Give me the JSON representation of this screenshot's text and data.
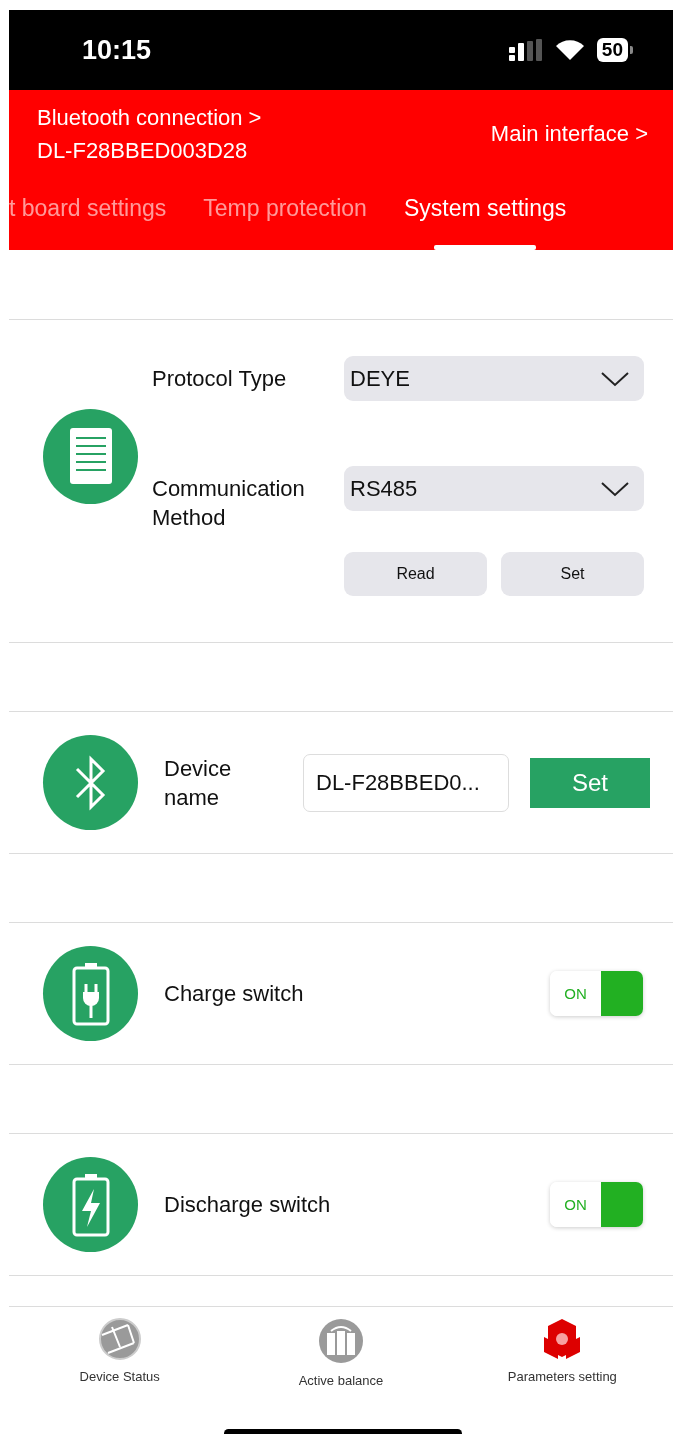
{
  "status_bar": {
    "time": "10:15",
    "battery": "50"
  },
  "header": {
    "connection_label": "Bluetooth connection >",
    "device_id": "DL-F28BBED003D28",
    "main_link": "Main interface >"
  },
  "tabs": [
    {
      "label": "t board settings",
      "selected": false
    },
    {
      "label": "Temp protection",
      "selected": false
    },
    {
      "label": "System settings",
      "selected": true
    }
  ],
  "protocol_section": {
    "fields": [
      {
        "label": "Protocol Type",
        "value": "DEYE"
      },
      {
        "label": "Communication Method",
        "value": "RS485"
      }
    ],
    "buttons": [
      "Read",
      "Set"
    ]
  },
  "device_name_section": {
    "label": "Device name",
    "value": "DL-F28BBED0...",
    "button": "Set"
  },
  "switches": [
    {
      "kind": "charge",
      "label": "Charge switch",
      "on": true,
      "state_label": "ON"
    },
    {
      "kind": "discharge",
      "label": "Discharge switch",
      "on": true,
      "state_label": "ON"
    }
  ],
  "bottom_tabs": [
    {
      "kind": "status",
      "label": "Device Status",
      "selected": false
    },
    {
      "kind": "balance",
      "label": "Active balance",
      "selected": false
    },
    {
      "kind": "params",
      "label": "Parameters setting",
      "selected": true
    }
  ]
}
